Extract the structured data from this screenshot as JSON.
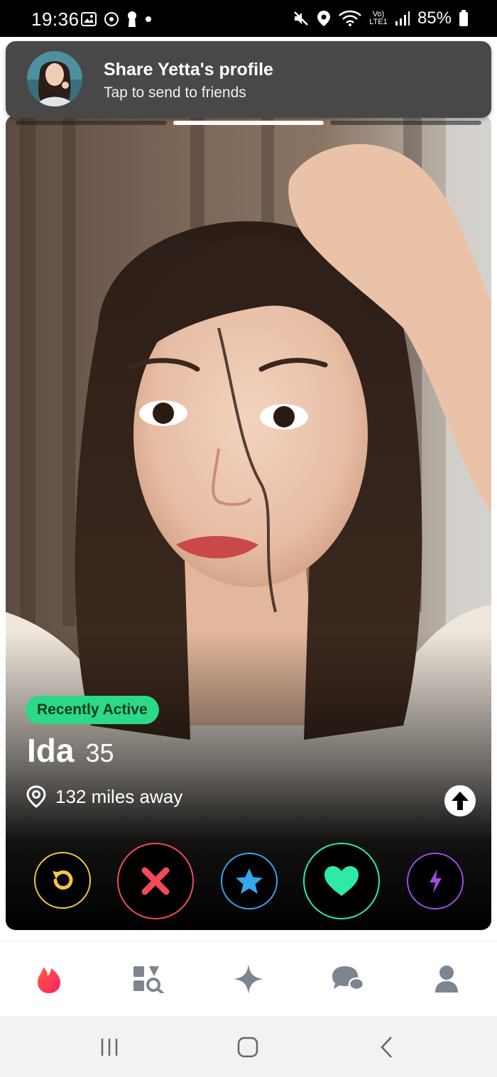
{
  "status_bar": {
    "time": "19:36",
    "battery": "85%",
    "network": "Vo) LTE1"
  },
  "share_banner": {
    "title": "Share Yetta's profile",
    "subtitle": "Tap to send to friends"
  },
  "profile": {
    "badge": "Recently Active",
    "name": "Ida",
    "age": "35",
    "distance": "132 miles away",
    "photo_count": 3,
    "active_photo_index": 2
  },
  "actions": [
    "rewind",
    "nope",
    "super-like",
    "like",
    "boost"
  ],
  "colors": {
    "rewind": "#f2c744",
    "nope": "#f14a58",
    "superlike": "#35a7ee",
    "like": "#2ee9a8",
    "boost": "#a34ae8",
    "badge": "#2bd986",
    "brand": "#fd2c6a"
  },
  "tabs": [
    "flame-icon",
    "explore-icon",
    "sparkle-icon",
    "chat-icon",
    "profile-icon"
  ]
}
